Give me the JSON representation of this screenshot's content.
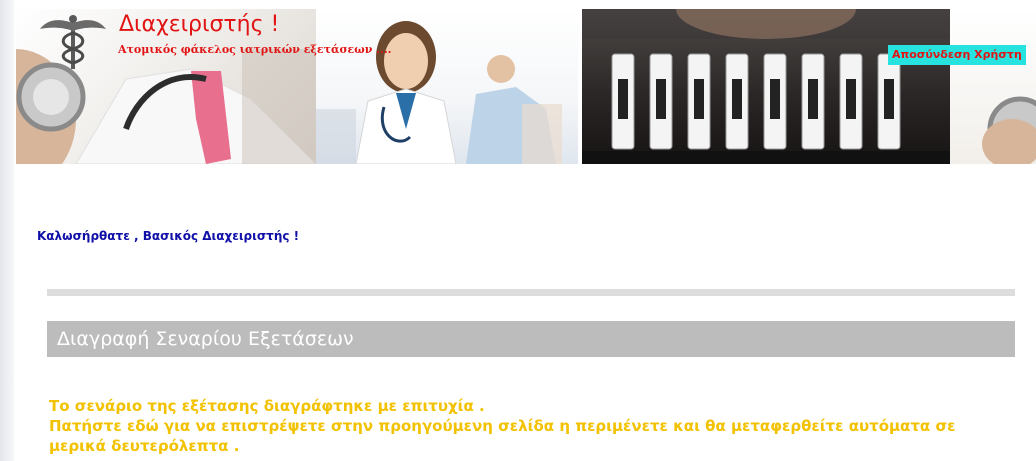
{
  "header": {
    "title": "Διαχειριστής !",
    "subtitle": "Ατομικός φάκελος ιατρικών εξετάσεων ....",
    "logout_label": "Αποσύνδεση Χρήστη"
  },
  "welcome_text": "Καλωσήρθατε , Βασικός Διαχειριστής !",
  "section": {
    "title": "Διαγραφή Σεναρίου Εξετάσεων"
  },
  "message": {
    "line1": "Το σενάριο της εξέτασης διαγράφτηκε με επιτυχία .",
    "line2_before": "Πατήστε ",
    "line2_link": "εδώ",
    "line2_after": " για να επιστρέψετε στην προηγούμενη σελίδα η περιμένετε και θα μεταφερθείτε αυτόματα σε μερικά δευτερόλεπτα ."
  },
  "colors": {
    "title_red": "#e11414",
    "welcome_blue": "#1010a8",
    "section_gray": "#bcbcbc",
    "message_yellow": "#f2c200",
    "logout_bg": "#27e3e0"
  },
  "icons": {
    "logo": "caduceus-icon"
  }
}
